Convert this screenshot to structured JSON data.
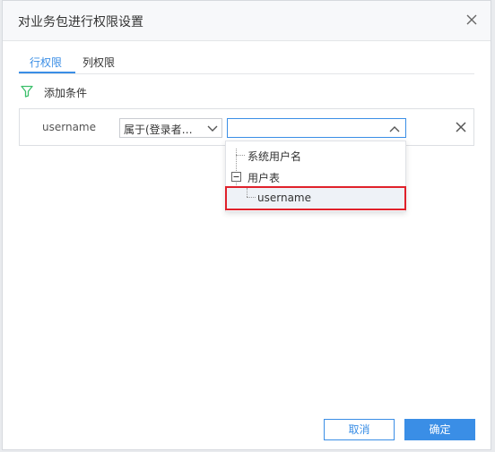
{
  "dialog": {
    "title": "对业务包进行权限设置"
  },
  "tabs": [
    {
      "label": "行权限",
      "active": true
    },
    {
      "label": "列权限",
      "active": false
    }
  ],
  "add_condition_label": "添加条件",
  "condition": {
    "field": "username",
    "operator_value": "属于(登录者…",
    "value": ""
  },
  "dropdown": {
    "items": [
      {
        "label": "系统用户名"
      },
      {
        "label": "用户表",
        "expanded": true,
        "children": [
          {
            "label": "username",
            "highlighted": true
          }
        ]
      }
    ]
  },
  "footer": {
    "cancel_label": "取消",
    "ok_label": "确定"
  },
  "colors": {
    "accent": "#3a8ee6",
    "highlight_border": "#e0212b",
    "filter_icon": "#3bbf6b"
  },
  "icons": [
    "close-icon",
    "filter-icon",
    "chevron-down-icon",
    "chevron-up-icon",
    "remove-icon",
    "collapse-icon"
  ]
}
